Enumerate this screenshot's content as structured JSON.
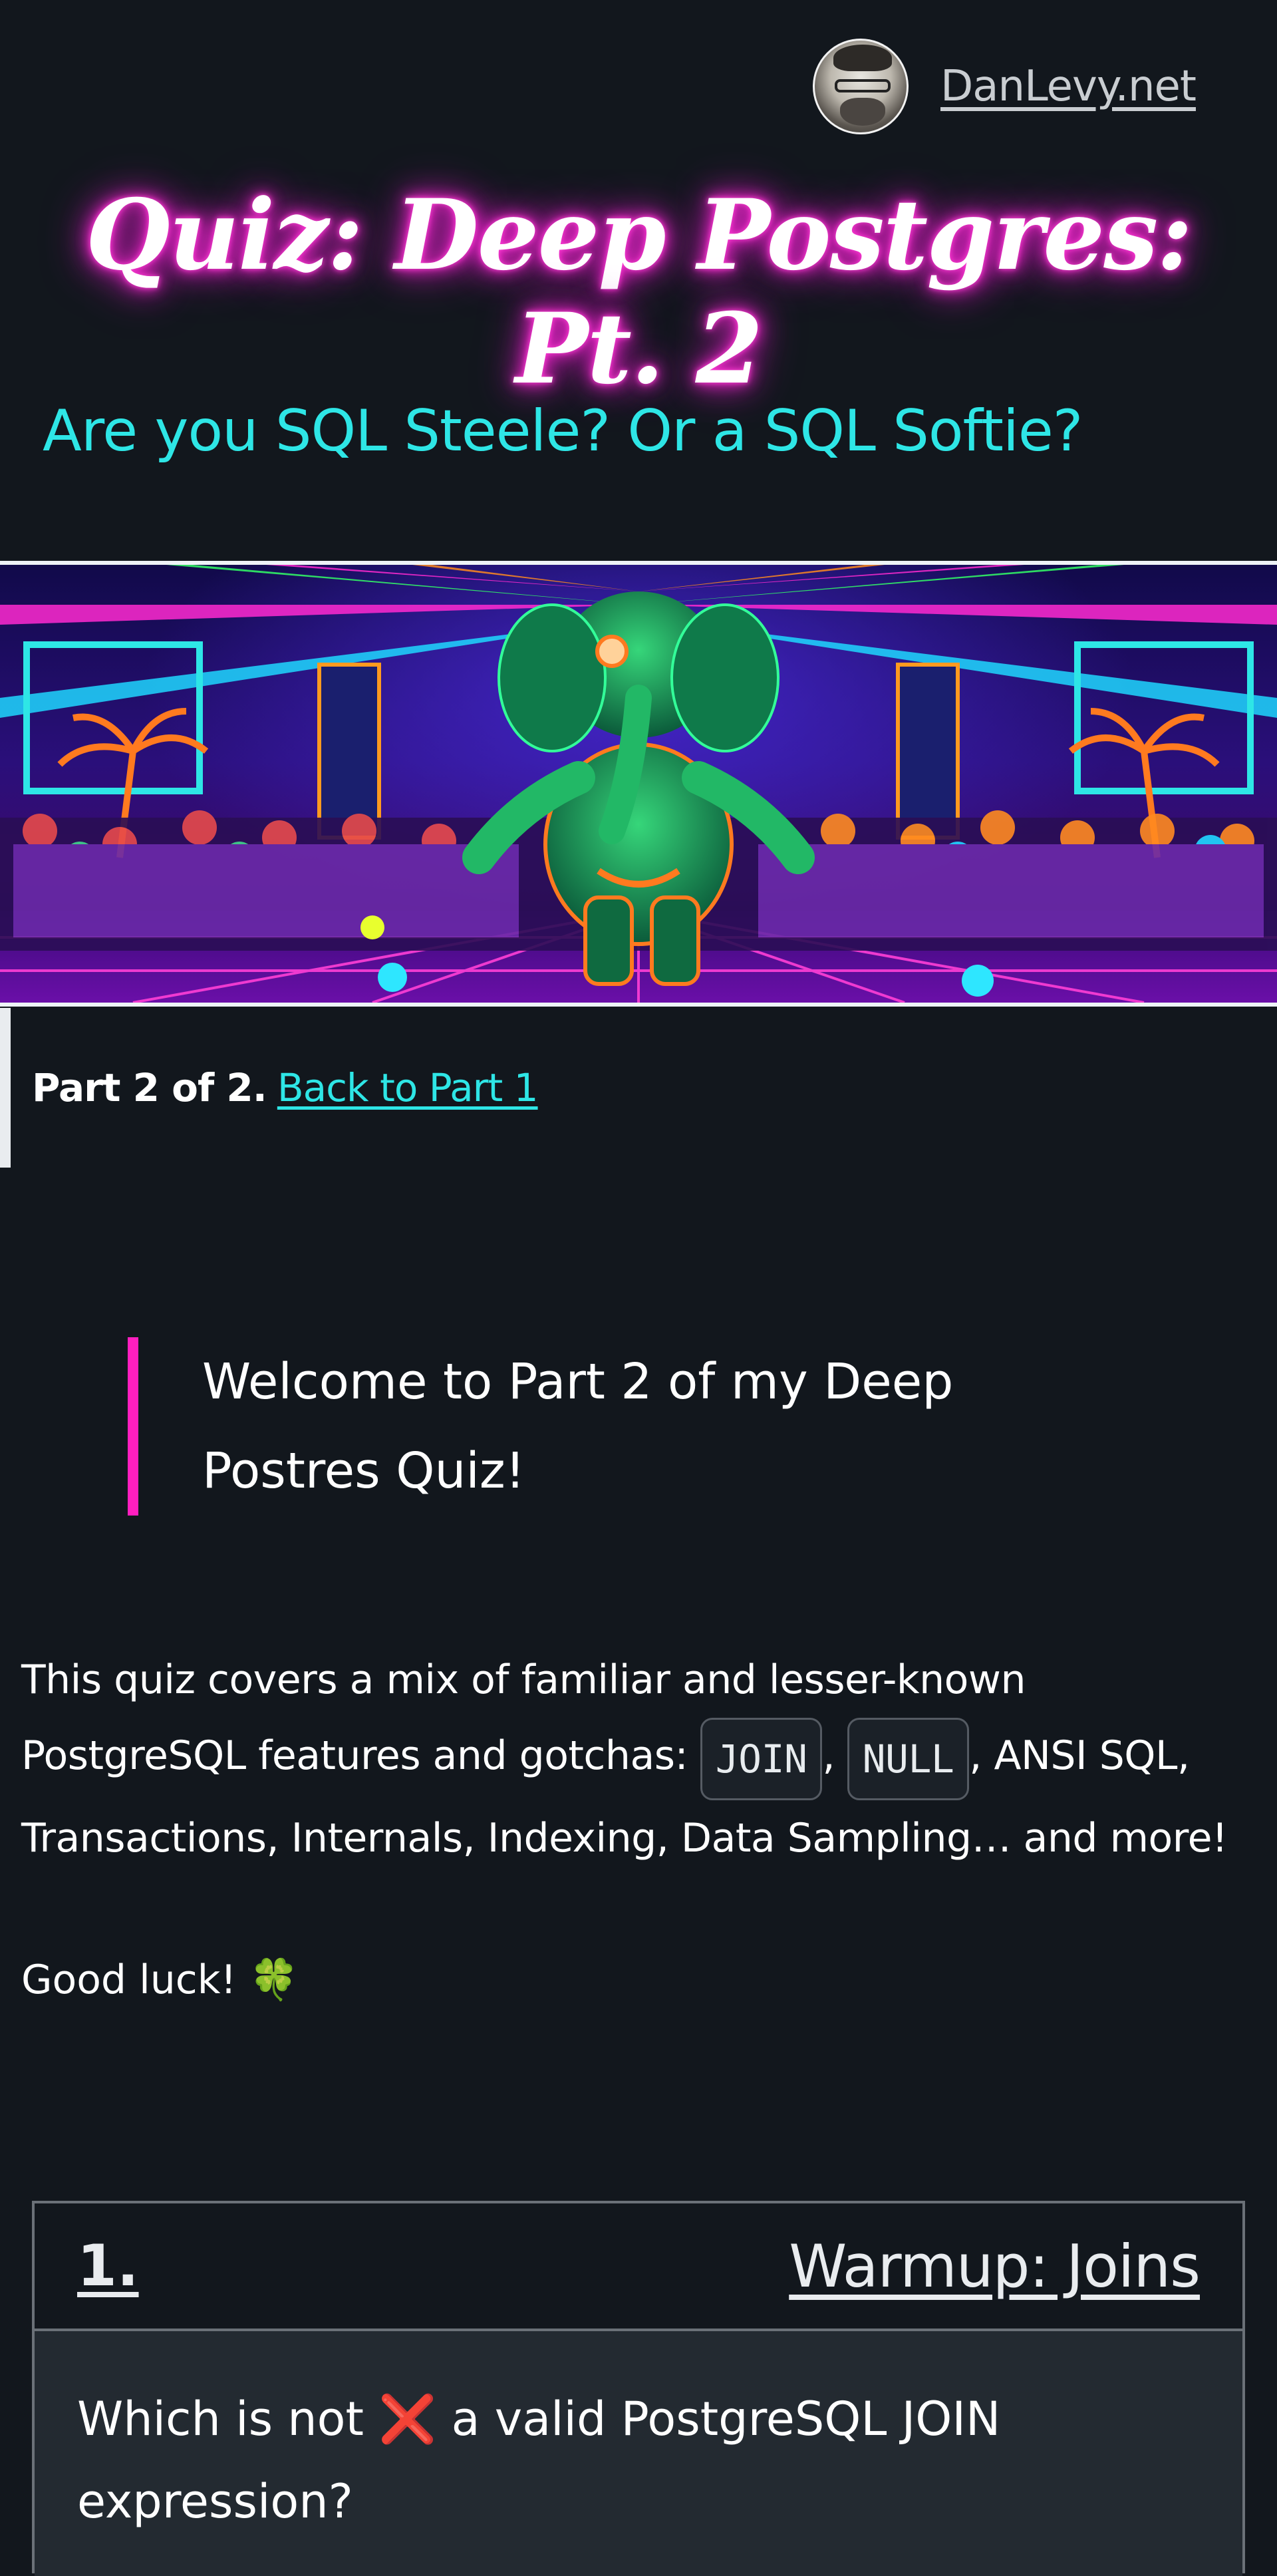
{
  "header": {
    "site_name": "DanLevy.net",
    "title": "Quiz: Deep Postgres: Pt. 2",
    "subtitle": "Are you SQL Steele? Or a SQL Softie?"
  },
  "hero": {
    "alt": "neon-elephant-dance-party-image"
  },
  "part_note": {
    "prefix": "Part 2 of 2.",
    "link_label": "Back to Part 1"
  },
  "quote": {
    "text": "Welcome to Part 2 of my Deep Postres Quiz!"
  },
  "intro": {
    "line1": "This quiz covers a mix of familiar and lesser-known PostgreSQL features and gotchas: ",
    "code1": "JOIN",
    "sep": ", ",
    "code2": "NULL",
    "rest": ", ANSI SQL, Transactions, Internals, Indexing, Data Sampling… and more!"
  },
  "luck": {
    "text": "Good luck! ",
    "emoji": "🍀"
  },
  "question": {
    "number": "1.",
    "category": "Warmup: Joins",
    "prefix": "Which is not ",
    "mark": "❌",
    "suffix": " a valid PostgreSQL JOIN expression?"
  },
  "colors": {
    "background": "#12171d",
    "accent_cyan": "#2ee6e6",
    "accent_pink": "#ff1fbf",
    "card_body": "#232a31"
  }
}
